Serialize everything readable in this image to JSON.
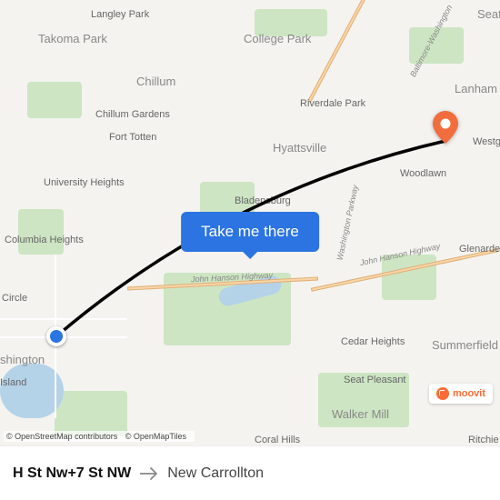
{
  "route": {
    "from": "H St Nw+7 St NW",
    "to": "New Carrollton",
    "cta_label": "Take me there"
  },
  "attribution": {
    "osm": "© OpenStreetMap contributors",
    "tiles": "© OpenMapTiles"
  },
  "branding": {
    "logo_text": "moovit"
  },
  "map_labels": {
    "langley_park": "Langley Park",
    "takoma_park": "Takoma Park",
    "college_park": "College Park",
    "chillum": "Chillum",
    "chillum_gardens": "Chillum Gardens",
    "riverdale_park": "Riverdale Park",
    "lanham": "Lanham",
    "fort_totten": "Fort Totten",
    "hyattsville": "Hyattsville",
    "westgate": "Westgate",
    "university_heights": "University Heights",
    "bladensburg": "Bladensburg",
    "woodlawn": "Woodlawn",
    "columbia_heights": "Columbia Heights",
    "glenarden": "Glenarden",
    "circle": "Circle",
    "cedar_heights": "Cedar Heights",
    "summerfield": "Summerfield",
    "washington": "shington",
    "island": "Island",
    "seat_pleasant": "Seat Pleasant",
    "walker_mill": "Walker Mill",
    "coral_hills": "Coral Hills",
    "ritchie": "Ritchie",
    "seat": "Seat",
    "john_hanson": "John Hanson Highway",
    "balt_wash": "Baltimore-Washington",
    "wash_pkwy": "Washington Parkway"
  }
}
